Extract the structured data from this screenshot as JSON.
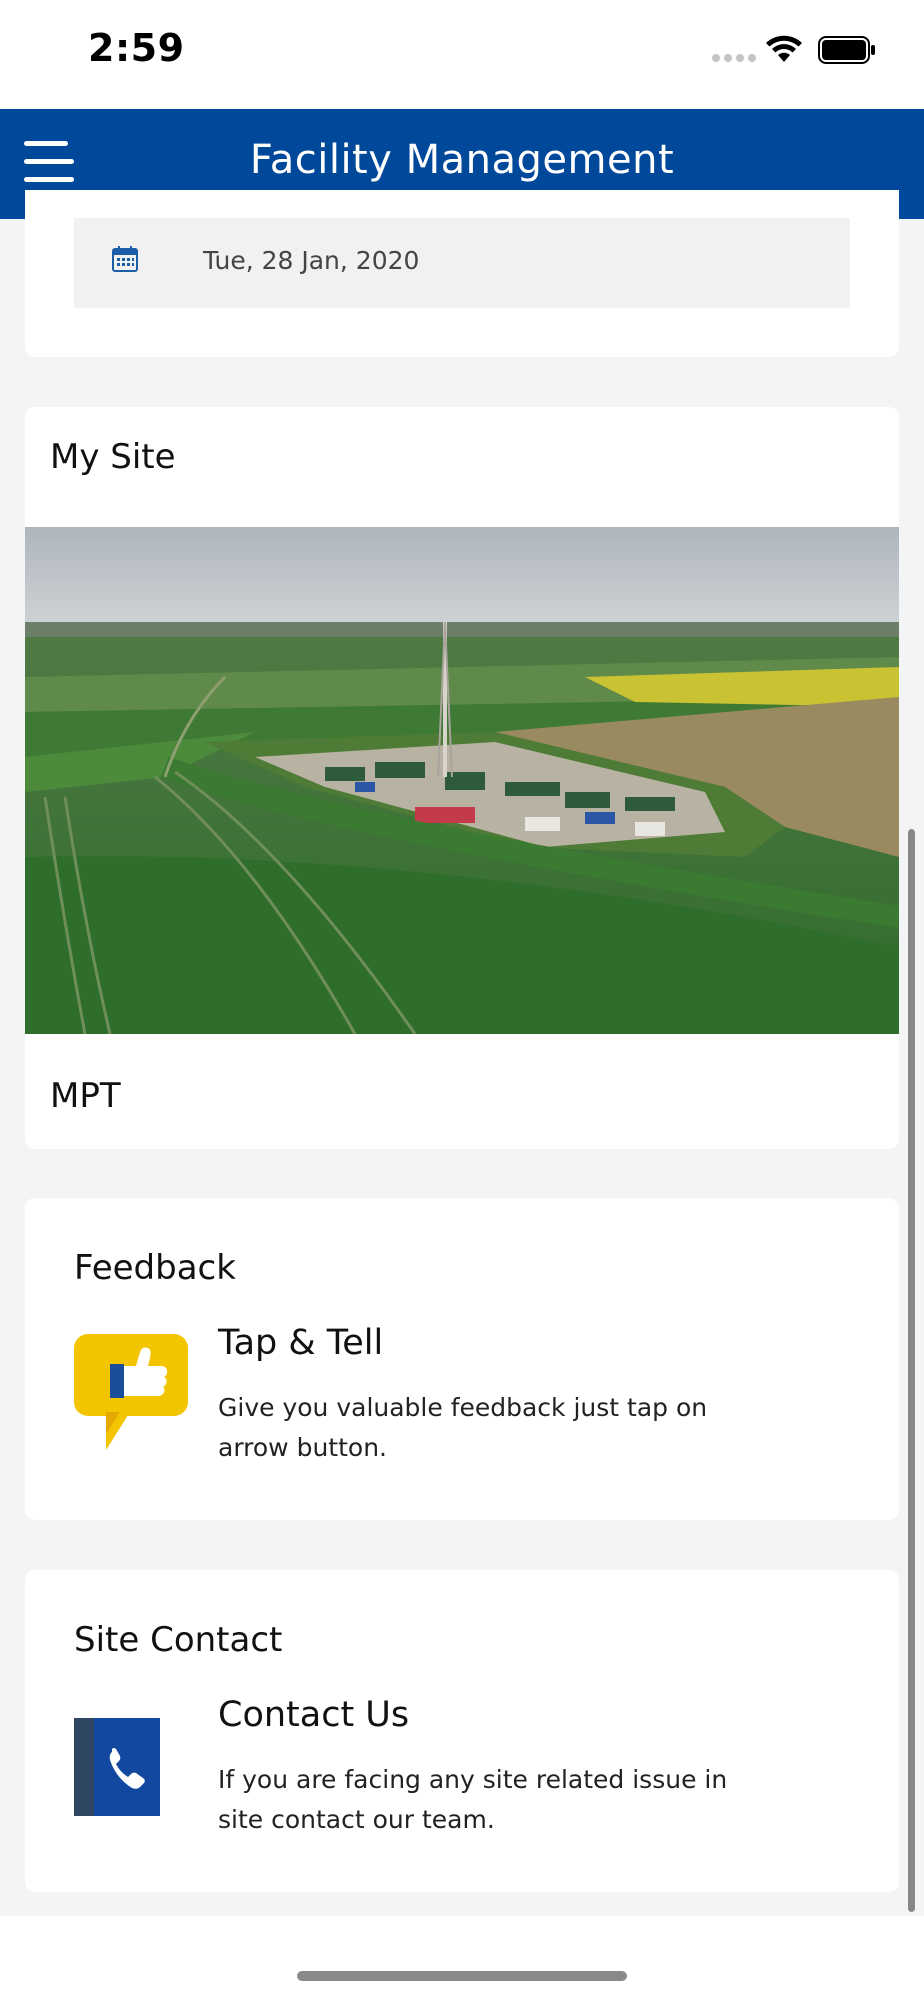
{
  "status_bar": {
    "time": "2:59"
  },
  "header": {
    "title": "Facility Management",
    "menu_icon": "hamburger-menu-icon",
    "background_color": "#004899"
  },
  "date_card": {
    "icon": "calendar-icon",
    "date": "Tue, 28 Jan, 2020"
  },
  "my_site": {
    "heading": "My Site",
    "image": "site-aerial-photo",
    "site_name": "MPT"
  },
  "feedback": {
    "heading": "Feedback",
    "icon": "thumbs-up-icon",
    "title": "Tap & Tell",
    "description": "Give you valuable feedback just tap on arrow button."
  },
  "site_contact": {
    "heading": "Site Contact",
    "icon": "phone-book-icon",
    "title": "Contact Us",
    "description": "If you are facing any site related issue in site contact our team."
  }
}
